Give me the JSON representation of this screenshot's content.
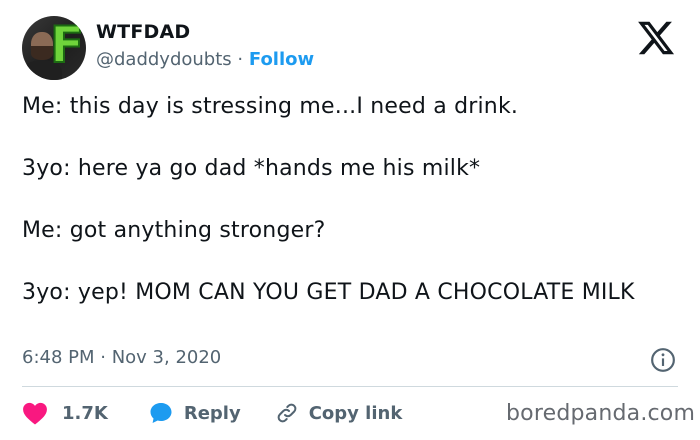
{
  "author": {
    "name": "WTFDAD",
    "handle": "@daddydoubts",
    "separator": "·",
    "follow_label": "Follow"
  },
  "tweet": {
    "lines": [
      "Me: this day is stressing me...I need a drink.",
      "3yo: here ya go dad *hands me his milk*",
      "Me: got anything stronger?",
      "3yo: yep! MOM CAN YOU GET DAD A CHOCOLATE MILK"
    ],
    "timestamp": "6:48 PM · Nov 3, 2020"
  },
  "actions": {
    "likes": "1.7K",
    "reply_label": "Reply",
    "copy_label": "Copy link"
  },
  "watermark": "boredpanda.com",
  "colors": {
    "like": "#f91880",
    "accent": "#1d9bf0",
    "secondary_text": "#536471"
  },
  "icons": [
    "avatar",
    "x-logo-icon",
    "info-icon",
    "heart-icon",
    "reply-bubble-icon",
    "link-icon"
  ]
}
